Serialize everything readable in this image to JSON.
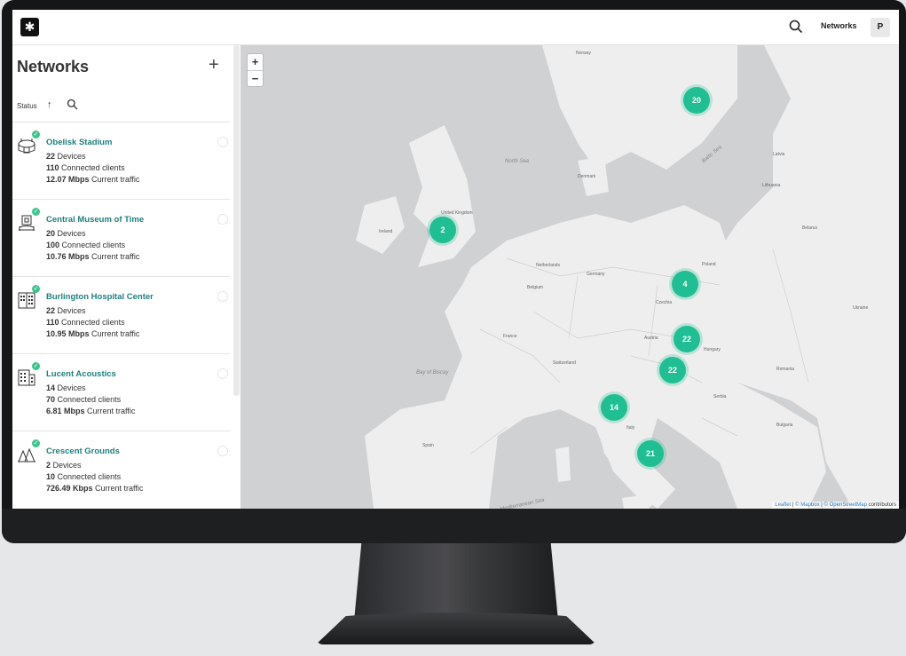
{
  "topbar": {
    "logo_glyph": "✱",
    "search_icon": "search-icon",
    "networks_label": "Networks",
    "avatar_initial": "P"
  },
  "sidebar": {
    "title": "Networks",
    "add_label": "+",
    "status_label": "Status",
    "status_arrow": "↑",
    "items": [
      {
        "name": "Obelisk Stadium",
        "devices": "22",
        "devices_label": "Devices",
        "clients": "110",
        "clients_label": "Connected clients",
        "traffic": "12.07 Mbps",
        "traffic_label": "Current traffic",
        "icon": "stadium-icon"
      },
      {
        "name": "Central Museum of Time",
        "devices": "20",
        "devices_label": "Devices",
        "clients": "100",
        "clients_label": "Connected clients",
        "traffic": "10.76 Mbps",
        "traffic_label": "Current traffic",
        "icon": "museum-icon"
      },
      {
        "name": "Burlington Hospital Center",
        "devices": "22",
        "devices_label": "Devices",
        "clients": "110",
        "clients_label": "Connected clients",
        "traffic": "10.95 Mbps",
        "traffic_label": "Current traffic",
        "icon": "hospital-icon"
      },
      {
        "name": "Lucent Acoustics",
        "devices": "14",
        "devices_label": "Devices",
        "clients": "70",
        "clients_label": "Connected clients",
        "traffic": "6.81 Mbps",
        "traffic_label": "Current traffic",
        "icon": "building-icon"
      },
      {
        "name": "Crescent Grounds",
        "devices": "2",
        "devices_label": "Devices",
        "clients": "10",
        "clients_label": "Connected clients",
        "traffic": "726.49 Kbps",
        "traffic_label": "Current traffic",
        "icon": "park-icon"
      }
    ]
  },
  "map": {
    "zoom_in": "+",
    "zoom_out": "−",
    "clusters": [
      "20",
      "2",
      "4",
      "22",
      "22",
      "14",
      "21"
    ],
    "labels": {
      "north_sea": "North Sea",
      "baltic": "Baltic Sea",
      "biscay": "Bay of Biscay",
      "med": "Mediterranean Sea",
      "norway": "Norway",
      "ireland": "Ireland",
      "uk": "United Kingdom",
      "denmark": "Denmark",
      "germany": "Germany",
      "poland": "Poland",
      "france": "France",
      "spain": "Spain",
      "italy": "Italy",
      "austria": "Austria",
      "hungary": "Hungary",
      "romania": "Romania",
      "ukraine": "Ukraine",
      "belarus": "Belarus",
      "czechia": "Czechia",
      "switzerland": "Switzerland",
      "serbia": "Serbia",
      "bulgaria": "Bulgaria",
      "belgium": "Belgium",
      "netherlands": "Netherlands",
      "lithuania": "Lithuania",
      "latvia": "Latvia"
    },
    "attribution_leaflet": "Leaflet",
    "attribution_mapbox": "© Mapbox",
    "attribution_osm": "© OpenStreetMap",
    "attribution_suffix": "contributors"
  }
}
